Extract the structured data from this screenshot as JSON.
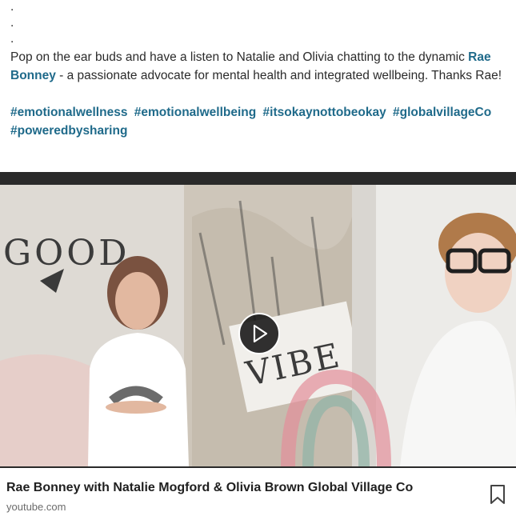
{
  "post": {
    "dots": [
      ".",
      ".",
      "."
    ],
    "intro": "Pop on the ear buds and have a listen to Natalie and Olivia chatting to the dynamic ",
    "mention": "Rae Bonney",
    "mention_suffix": " - a passionate advocate for mental health and integrated wellbeing. Thanks Rae!",
    "hashtags": [
      "#emotionalwellness",
      "#emotionalwellbeing",
      "#itsokaynottobeokay",
      "#globalvillageCo",
      "#poweredbysharing"
    ]
  },
  "video": {
    "wall_text_1": "GOOD",
    "wall_text_2": "VIBE",
    "play_icon": "play-icon"
  },
  "card": {
    "title": "Rae Bonney with Natalie Mogford & Olivia Brown Global Village Co",
    "source": "youtube.com",
    "save_icon": "bookmark-icon"
  },
  "colors": {
    "link": "#1f6a8a",
    "text": "#2b2b2b",
    "video_border": "#2a2a2a"
  }
}
